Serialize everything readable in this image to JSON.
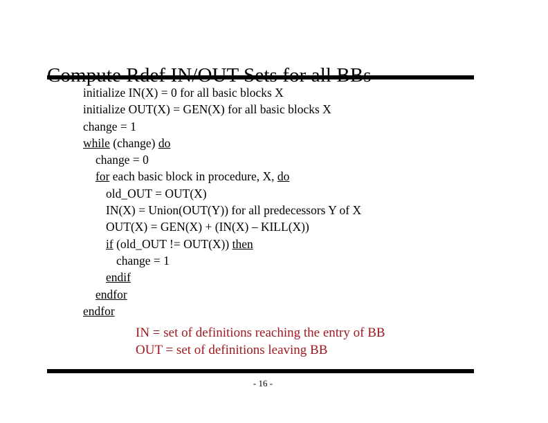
{
  "slide": {
    "title": "Compute Rdef IN/OUT Sets for all BBs",
    "page_number": "- 16 -",
    "accent_color": "#A01820",
    "text_color": "#000000",
    "background_color": "#FFFFFF"
  },
  "pseudocode": {
    "lines": [
      {
        "indent": 0,
        "segments": [
          {
            "text": "initialize IN(X) = 0 for all basic blocks X",
            "keyword": false
          }
        ]
      },
      {
        "indent": 0,
        "segments": [
          {
            "text": "initialize OUT(X) = GEN(X) for all basic blocks X",
            "keyword": false
          }
        ]
      },
      {
        "indent": 0,
        "segments": [
          {
            "text": "change = 1",
            "keyword": false
          }
        ]
      },
      {
        "indent": 0,
        "segments": [
          {
            "text": "while",
            "keyword": true
          },
          {
            "text": " (change) ",
            "keyword": false
          },
          {
            "text": "do",
            "keyword": true
          }
        ]
      },
      {
        "indent": 1,
        "segments": [
          {
            "text": "change = 0",
            "keyword": false
          }
        ]
      },
      {
        "indent": 1,
        "segments": [
          {
            "text": "for",
            "keyword": true
          },
          {
            "text": " each basic block in procedure, X, ",
            "keyword": false
          },
          {
            "text": "do",
            "keyword": true
          }
        ]
      },
      {
        "indent": 2,
        "segments": [
          {
            "text": "old_OUT = OUT(X)",
            "keyword": false
          }
        ]
      },
      {
        "indent": 2,
        "segments": [
          {
            "text": "IN(X) = Union(OUT(Y)) for all predecessors Y of X",
            "keyword": false
          }
        ]
      },
      {
        "indent": 2,
        "segments": [
          {
            "text": "OUT(X) = GEN(X) + (IN(X) – KILL(X))",
            "keyword": false
          }
        ]
      },
      {
        "indent": 2,
        "segments": [
          {
            "text": "if",
            "keyword": true
          },
          {
            "text": " (old_OUT != OUT(X)) ",
            "keyword": false
          },
          {
            "text": "then",
            "keyword": true
          }
        ]
      },
      {
        "indent": 3,
        "segments": [
          {
            "text": "change = 1",
            "keyword": false
          }
        ]
      },
      {
        "indent": 2,
        "segments": [
          {
            "text": "endif",
            "keyword": true
          }
        ]
      },
      {
        "indent": 1,
        "segments": [
          {
            "text": "endfor",
            "keyword": true
          }
        ]
      },
      {
        "indent": 0,
        "segments": [
          {
            "text": "endfor",
            "keyword": true
          }
        ]
      }
    ]
  },
  "legend": {
    "lines": [
      "IN = set of definitions reaching the entry of BB",
      "OUT = set of definitions leaving BB"
    ]
  }
}
